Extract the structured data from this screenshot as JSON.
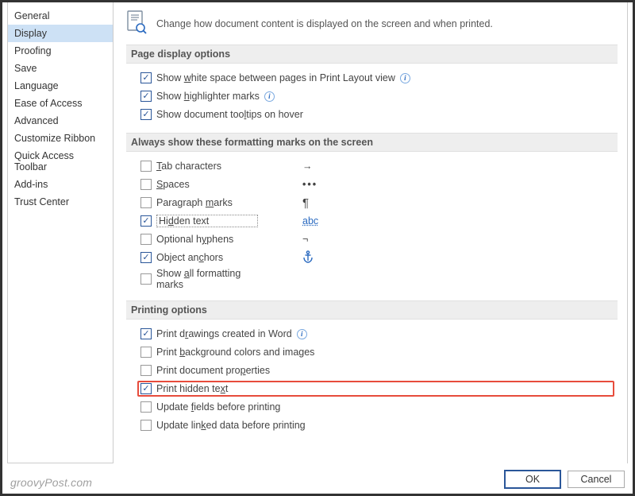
{
  "sidebar": {
    "items": [
      {
        "label": "General"
      },
      {
        "label": "Display"
      },
      {
        "label": "Proofing"
      },
      {
        "label": "Save"
      },
      {
        "label": "Language"
      },
      {
        "label": "Ease of Access"
      },
      {
        "label": "Advanced"
      },
      {
        "label": "Customize Ribbon"
      },
      {
        "label": "Quick Access Toolbar"
      },
      {
        "label": "Add-ins"
      },
      {
        "label": "Trust Center"
      }
    ],
    "selected_index": 1
  },
  "hero_text": "Change how document content is displayed on the screen and when printed.",
  "sections": {
    "page_display": {
      "title": "Page display options",
      "opts": {
        "whitespace": {
          "label": "Show white space between pages in Print Layout view",
          "checked": true,
          "info": true
        },
        "highlighter": {
          "label": "Show highlighter marks",
          "checked": true,
          "info": true
        },
        "tooltips": {
          "label": "Show document tooltips on hover",
          "checked": true,
          "info": false
        }
      }
    },
    "format_marks": {
      "title": "Always show these formatting marks on the screen",
      "opts": {
        "tab": {
          "label": "Tab characters",
          "checked": false,
          "symbol": "→"
        },
        "spaces": {
          "label": "Spaces",
          "checked": false,
          "symbol": "•••"
        },
        "paragraph": {
          "label": "Paragraph marks",
          "checked": false,
          "symbol": "¶"
        },
        "hidden": {
          "label": "Hidden text",
          "checked": true,
          "symbol": "abc"
        },
        "hyphens": {
          "label": "Optional hyphens",
          "checked": false,
          "symbol": "¬"
        },
        "anchors": {
          "label": "Object anchors",
          "checked": true,
          "symbol": "⚓"
        },
        "all": {
          "label": "Show all formatting marks",
          "checked": false
        }
      }
    },
    "printing": {
      "title": "Printing options",
      "opts": {
        "drawings": {
          "label": "Print drawings created in Word",
          "checked": true,
          "info": true
        },
        "background": {
          "label": "Print background colors and images",
          "checked": false
        },
        "properties": {
          "label": "Print document properties",
          "checked": false
        },
        "hidden_text": {
          "label": "Print hidden text",
          "checked": true,
          "highlight": true
        },
        "update_fields": {
          "label": "Update fields before printing",
          "checked": false
        },
        "update_linked": {
          "label": "Update linked data before printing",
          "checked": false
        }
      }
    }
  },
  "buttons": {
    "ok": "OK",
    "cancel": "Cancel"
  },
  "watermark": "groovyPost.com"
}
